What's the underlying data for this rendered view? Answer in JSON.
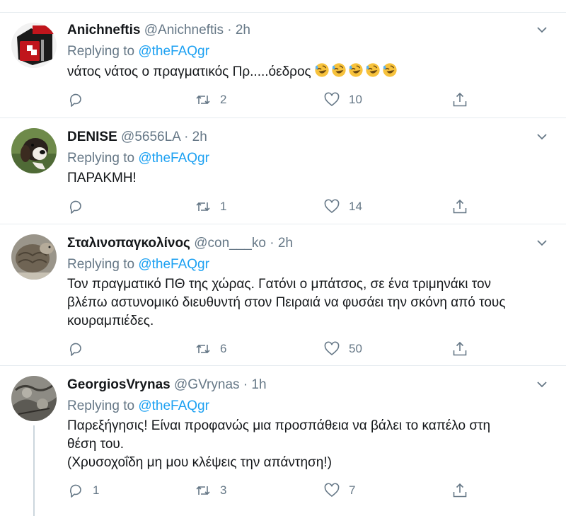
{
  "replying_label": "Replying to",
  "tweets": [
    {
      "name": "Anichneftis",
      "handle": "@Anichneftis",
      "separator": "·",
      "time": "2h",
      "reply_to": "@theFAQgr",
      "text_lines": [
        "νάτος νάτος ο πραγματικός Πρ.....όεδρος"
      ],
      "emoji": "rolling-on-floor-laughing",
      "emoji_count": 5,
      "replies": "",
      "retweets": "2",
      "likes": "10"
    },
    {
      "name": "DENISE",
      "handle": "@5656LA",
      "separator": "·",
      "time": "2h",
      "reply_to": "@theFAQgr",
      "text_lines": [
        "ΠΑΡΑΚΜΗ!"
      ],
      "replies": "",
      "retweets": "1",
      "likes": "14"
    },
    {
      "name": "Σταλινοπαγκολίνος",
      "handle": "@con___ko",
      "separator": "·",
      "time": "2h",
      "reply_to": "@theFAQgr",
      "text_lines": [
        "Τον πραγματικό ΠΘ της χώρας. Γατόνι ο μπάτσος, σε ένα τριμηνάκι τον",
        "βλέπω αστυνομικό διευθυντή στον Πειραιά να φυσάει την σκόνη από τους",
        "κουραμπιέδες."
      ],
      "replies": "",
      "retweets": "6",
      "likes": "50"
    },
    {
      "name": "GeorgiosVrynas",
      "handle": "@GVrynas",
      "separator": "·",
      "time": "1h",
      "reply_to": "@theFAQgr",
      "text_lines": [
        "Παρεξήγησις! Είναι προφανώς μια προσπάθεια να βάλει το καπέλο στη",
        "θέση του.",
        "(Χρυσοχοΐδη μη μου κλέψεις την απάντηση!)"
      ],
      "replies": "1",
      "retweets": "3",
      "likes": "7"
    }
  ],
  "colors": {
    "accent": "#1da1f2",
    "secondary_text": "#657786",
    "divider": "#e6ecf0",
    "thread_line": "#ccd6dd"
  }
}
